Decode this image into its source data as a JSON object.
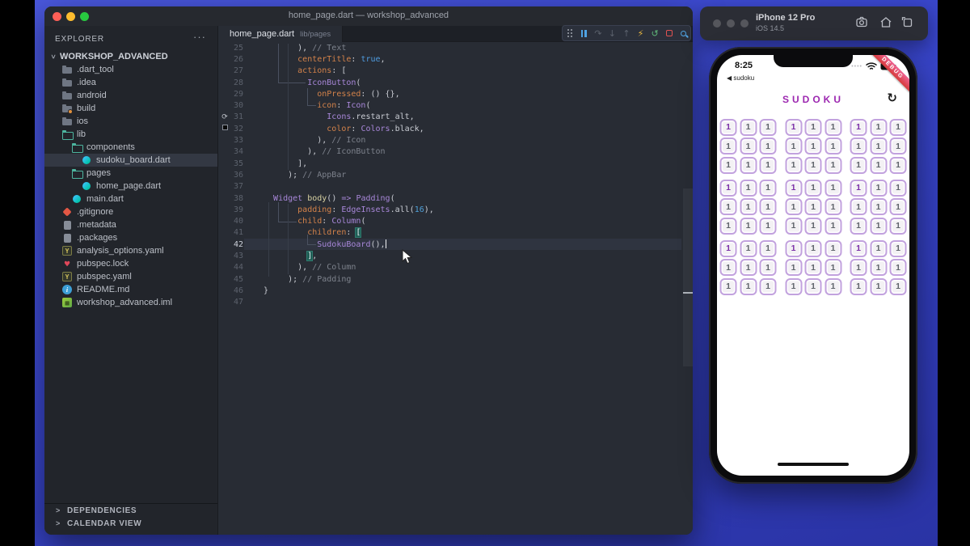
{
  "window": {
    "title": "home_page.dart — workshop_advanced"
  },
  "explorer": {
    "header": "EXPLORER",
    "menu_icon": "ellipsis-icon",
    "root_label": "WORKSHOP_ADVANCED",
    "items": [
      {
        "label": ".dart_tool",
        "indent": 1,
        "icon": "folder"
      },
      {
        "label": ".idea",
        "indent": 1,
        "icon": "folder"
      },
      {
        "label": "android",
        "indent": 1,
        "icon": "folder"
      },
      {
        "label": "build",
        "indent": 1,
        "icon": "folder-badge"
      },
      {
        "label": "ios",
        "indent": 1,
        "icon": "folder"
      },
      {
        "label": "lib",
        "indent": 1,
        "icon": "folder-open"
      },
      {
        "label": "components",
        "indent": 2,
        "icon": "folder-open"
      },
      {
        "label": "sudoku_board.dart",
        "indent": 3,
        "icon": "dart",
        "selected": true
      },
      {
        "label": "pages",
        "indent": 2,
        "icon": "folder-open"
      },
      {
        "label": "home_page.dart",
        "indent": 3,
        "icon": "dart"
      },
      {
        "label": "main.dart",
        "indent": 2,
        "icon": "dart"
      },
      {
        "label": ".gitignore",
        "indent": 1,
        "icon": "git"
      },
      {
        "label": ".metadata",
        "indent": 1,
        "icon": "file"
      },
      {
        "label": ".packages",
        "indent": 1,
        "icon": "file"
      },
      {
        "label": "analysis_options.yaml",
        "indent": 1,
        "icon": "yaml",
        "glyph": "Y"
      },
      {
        "label": "pubspec.lock",
        "indent": 1,
        "icon": "lock",
        "glyph": "♥"
      },
      {
        "label": "pubspec.yaml",
        "indent": 1,
        "icon": "yaml",
        "glyph": "Y"
      },
      {
        "label": "README.md",
        "indent": 1,
        "icon": "info",
        "glyph": "i"
      },
      {
        "label": "workshop_advanced.iml",
        "indent": 1,
        "icon": "iml",
        "glyph": "▦"
      }
    ],
    "sections": [
      {
        "label": "DEPENDENCIES"
      },
      {
        "label": "CALENDAR VIEW"
      }
    ]
  },
  "editor": {
    "tab": {
      "name": "home_page.dart",
      "path": "lib/pages"
    },
    "debug_toolbar": [
      {
        "name": "grip-icon",
        "kind": "grip",
        "color": "#8a8f99"
      },
      {
        "name": "pause-icon",
        "kind": "pause",
        "color": "#4fa3e3"
      },
      {
        "name": "step-over-icon",
        "kind": "glyph",
        "glyph": "↷",
        "color": "#5b616c"
      },
      {
        "name": "step-into-icon",
        "kind": "glyph",
        "glyph": "↓",
        "color": "#5b616c"
      },
      {
        "name": "step-out-icon",
        "kind": "glyph",
        "glyph": "↑",
        "color": "#5b616c"
      },
      {
        "name": "hot-reload-icon",
        "kind": "glyph",
        "glyph": "⚡",
        "color": "#e8b63f"
      },
      {
        "name": "restart-icon",
        "kind": "glyph",
        "glyph": "↺",
        "color": "#5fb878"
      },
      {
        "name": "stop-icon",
        "kind": "stop",
        "color": "#e05252"
      },
      {
        "name": "inspector-icon",
        "kind": "magnifier",
        "color": "#4fa3e3"
      }
    ],
    "lines": [
      {
        "n": 25,
        "s": [
          [
            "tp",
            "       ), "
          ],
          [
            "tm",
            "// Text"
          ]
        ]
      },
      {
        "n": 26,
        "s": [
          [
            "tp",
            "       "
          ],
          [
            "tk",
            "centerTitle"
          ],
          [
            "tp",
            ": "
          ],
          [
            "tb",
            "true"
          ],
          [
            "tp",
            ","
          ]
        ]
      },
      {
        "n": 27,
        "s": [
          [
            "tp",
            "       "
          ],
          [
            "tk",
            "actions"
          ],
          [
            "tp",
            ": ["
          ]
        ]
      },
      {
        "n": 28,
        "s": [
          [
            "tp",
            "         "
          ],
          [
            "tc",
            "IconButton"
          ],
          [
            "tp",
            "("
          ]
        ]
      },
      {
        "n": 29,
        "s": [
          [
            "tp",
            "           "
          ],
          [
            "tk",
            "onPressed"
          ],
          [
            "tp",
            ": () {},"
          ]
        ]
      },
      {
        "n": 30,
        "s": [
          [
            "tp",
            "           "
          ],
          [
            "tk",
            "icon"
          ],
          [
            "tp",
            ": "
          ],
          [
            "tc",
            "Icon"
          ],
          [
            "tp",
            "("
          ]
        ]
      },
      {
        "n": 31,
        "g": "reload",
        "s": [
          [
            "tp",
            "             "
          ],
          [
            "tc",
            "Icons"
          ],
          [
            "tp",
            ".restart_alt,"
          ]
        ]
      },
      {
        "n": 32,
        "g": "swatch",
        "s": [
          [
            "tp",
            "             "
          ],
          [
            "tk",
            "color"
          ],
          [
            "tp",
            ": "
          ],
          [
            "tc",
            "Colors"
          ],
          [
            "tp",
            ".black,"
          ]
        ]
      },
      {
        "n": 33,
        "s": [
          [
            "tp",
            "           ), "
          ],
          [
            "tm",
            "// Icon"
          ]
        ]
      },
      {
        "n": 34,
        "s": [
          [
            "tp",
            "         ), "
          ],
          [
            "tm",
            "// IconButton"
          ]
        ]
      },
      {
        "n": 35,
        "s": [
          [
            "tp",
            "       ],"
          ]
        ]
      },
      {
        "n": 36,
        "s": [
          [
            "tp",
            "     ); "
          ],
          [
            "tm",
            "// AppBar"
          ]
        ]
      },
      {
        "n": 37,
        "s": []
      },
      {
        "n": 38,
        "s": [
          [
            "tp",
            "  "
          ],
          [
            "tc",
            "Widget"
          ],
          [
            "tp",
            " "
          ],
          [
            "tf",
            "body"
          ],
          [
            "tp",
            "() "
          ],
          [
            "tc",
            "=>"
          ],
          [
            "tp",
            " "
          ],
          [
            "tc",
            "Padding"
          ],
          [
            "tp",
            "("
          ]
        ]
      },
      {
        "n": 39,
        "s": [
          [
            "tp",
            "       "
          ],
          [
            "tk",
            "padding"
          ],
          [
            "tp",
            ": "
          ],
          [
            "tc",
            "EdgeInsets"
          ],
          [
            "tp",
            ".all("
          ],
          [
            "tn",
            "16"
          ],
          [
            "tp",
            "),"
          ]
        ]
      },
      {
        "n": 40,
        "s": [
          [
            "tp",
            "       "
          ],
          [
            "tk",
            "child"
          ],
          [
            "tp",
            ": "
          ],
          [
            "tc",
            "Column"
          ],
          [
            "tp",
            "("
          ]
        ]
      },
      {
        "n": 41,
        "s": [
          [
            "tp",
            "         "
          ],
          [
            "tk",
            "children"
          ],
          [
            "tp",
            ": "
          ],
          [
            "tbm",
            "["
          ]
        ]
      },
      {
        "n": 42,
        "active": true,
        "caret": true,
        "s": [
          [
            "tp",
            "           "
          ],
          [
            "tc",
            "SudokuBoard"
          ],
          [
            "tp",
            "(),"
          ]
        ]
      },
      {
        "n": 43,
        "s": [
          [
            "tp",
            "         "
          ],
          [
            "tbm",
            "]"
          ],
          [
            "tp",
            ","
          ]
        ]
      },
      {
        "n": 44,
        "s": [
          [
            "tp",
            "       ), "
          ],
          [
            "tm",
            "// Column"
          ]
        ]
      },
      {
        "n": 45,
        "s": [
          [
            "tp",
            "     ); "
          ],
          [
            "tm",
            "// Padding"
          ]
        ]
      },
      {
        "n": 46,
        "s": [
          [
            "tp",
            "}"
          ]
        ]
      },
      {
        "n": 47,
        "s": []
      }
    ]
  },
  "simulator": {
    "window_title": "iPhone 12 Pro",
    "window_subtitle": "iOS 14.5",
    "toolbar_icons": [
      "screenshot-icon",
      "home-icon",
      "rotate-icon"
    ],
    "phone": {
      "status_time": "8:25",
      "back_label": "◀ sudoku",
      "debug_banner": "DEBUG",
      "app_title": "SUDOKU",
      "refresh_icon": "↻",
      "board": {
        "size": 9,
        "values": [
          [
            "1",
            "1",
            "1",
            "1",
            "1",
            "1",
            "1",
            "1",
            "1"
          ],
          [
            "1",
            "1",
            "1",
            "1",
            "1",
            "1",
            "1",
            "1",
            "1"
          ],
          [
            "1",
            "1",
            "1",
            "1",
            "1",
            "1",
            "1",
            "1",
            "1"
          ],
          [
            "1",
            "1",
            "1",
            "1",
            "1",
            "1",
            "1",
            "1",
            "1"
          ],
          [
            "1",
            "1",
            "1",
            "1",
            "1",
            "1",
            "1",
            "1",
            "1"
          ],
          [
            "1",
            "1",
            "1",
            "1",
            "1",
            "1",
            "1",
            "1",
            "1"
          ],
          [
            "1",
            "1",
            "1",
            "1",
            "1",
            "1",
            "1",
            "1",
            "1"
          ],
          [
            "1",
            "1",
            "1",
            "1",
            "1",
            "1",
            "1",
            "1",
            "1"
          ],
          [
            "1",
            "1",
            "1",
            "1",
            "1",
            "1",
            "1",
            "1",
            "1"
          ]
        ],
        "accent_cells": [
          [
            0,
            0
          ],
          [
            0,
            3
          ],
          [
            0,
            6
          ],
          [
            3,
            0
          ],
          [
            3,
            3
          ],
          [
            3,
            6
          ],
          [
            6,
            0
          ],
          [
            6,
            3
          ],
          [
            6,
            6
          ]
        ],
        "accent_color": "#7b2fa8",
        "cell_border_color": "#c2a2de"
      }
    }
  },
  "colors": {
    "desktop_blue": "#3a47cd",
    "sudoku_purple": "#9c27b0",
    "debug_banner_red": "#d63b3b"
  }
}
